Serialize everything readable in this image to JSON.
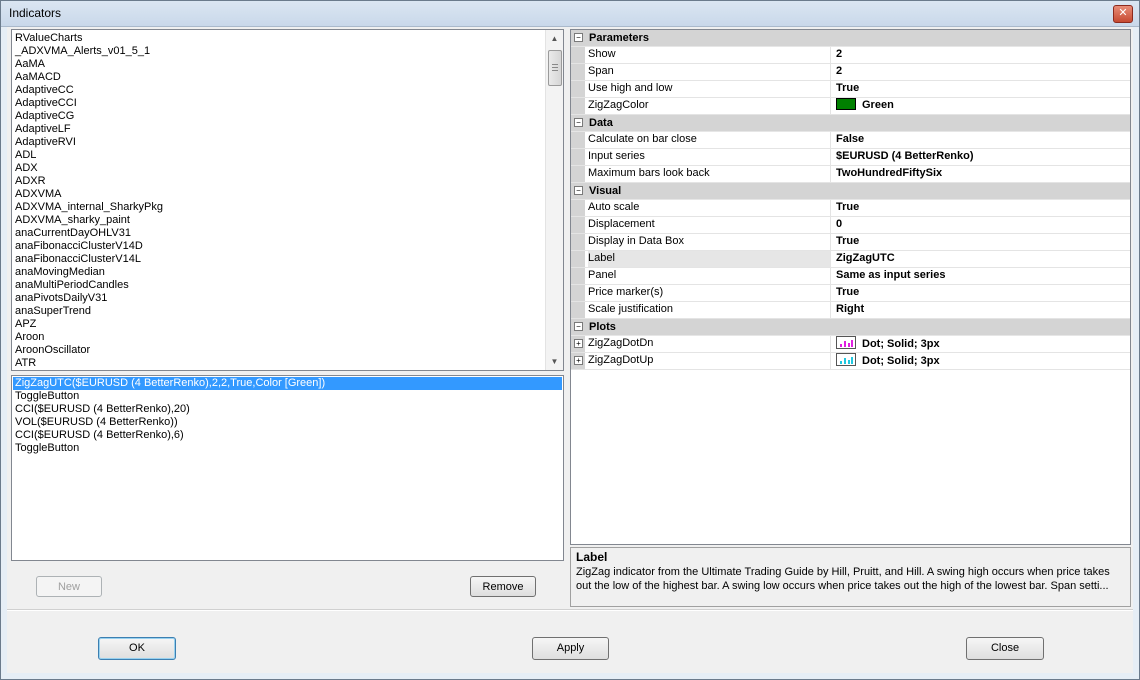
{
  "window": {
    "title": "Indicators"
  },
  "available_indicators": [
    "RValueCharts",
    "_ADXVMA_Alerts_v01_5_1",
    "AaMA",
    "AaMACD",
    "AdaptiveCC",
    "AdaptiveCCI",
    "AdaptiveCG",
    "AdaptiveLF",
    "AdaptiveRVI",
    "ADL",
    "ADX",
    "ADXR",
    "ADXVMA",
    "ADXVMA_internal_SharkyPkg",
    "ADXVMA_sharky_paint",
    "anaCurrentDayOHLV31",
    "anaFibonacciClusterV14D",
    "anaFibonacciClusterV14L",
    "anaMovingMedian",
    "anaMultiPeriodCandles",
    "anaPivotsDailyV31",
    "anaSuperTrend",
    "APZ",
    "Aroon",
    "AroonOscillator",
    "ATR"
  ],
  "applied_indicators": [
    {
      "label": "ZigZagUTC($EURUSD (4 BetterRenko),2,2,True,Color [Green])",
      "selected": true
    },
    {
      "label": "ToggleButton",
      "selected": false
    },
    {
      "label": "CCI($EURUSD (4 BetterRenko),20)",
      "selected": false
    },
    {
      "label": "VOL($EURUSD (4 BetterRenko))",
      "selected": false
    },
    {
      "label": "CCI($EURUSD (4 BetterRenko),6)",
      "selected": false
    },
    {
      "label": "ToggleButton",
      "selected": false
    }
  ],
  "buttons": {
    "new": "New",
    "remove": "Remove",
    "ok": "OK",
    "apply": "Apply",
    "close": "Close"
  },
  "properties": [
    {
      "category": "Parameters",
      "rows": [
        {
          "name": "Show",
          "value": "2"
        },
        {
          "name": "Span",
          "value": "2"
        },
        {
          "name": "Use high and low",
          "value": "True"
        },
        {
          "name": "ZigZagColor",
          "value": "Green",
          "swatch": "#008000"
        }
      ]
    },
    {
      "category": "Data",
      "rows": [
        {
          "name": "Calculate on bar close",
          "value": "False"
        },
        {
          "name": "Input series",
          "value": "$EURUSD (4 BetterRenko)"
        },
        {
          "name": "Maximum bars look back",
          "value": "TwoHundredFiftySix"
        }
      ]
    },
    {
      "category": "Visual",
      "rows": [
        {
          "name": "Auto scale",
          "value": "True"
        },
        {
          "name": "Displacement",
          "value": "0"
        },
        {
          "name": "Display in Data Box",
          "value": "True"
        },
        {
          "name": "Label",
          "value": "ZigZagUTC",
          "selected": true
        },
        {
          "name": "Panel",
          "value": "Same as input series"
        },
        {
          "name": "Price marker(s)",
          "value": "True"
        },
        {
          "name": "Scale justification",
          "value": "Right"
        }
      ]
    },
    {
      "category": "Plots",
      "rows": [
        {
          "name": "ZigZagDotDn",
          "value": "Dot; Solid; 3px",
          "plot_color": "#e020e0",
          "expandable": true
        },
        {
          "name": "ZigZagDotUp",
          "value": "Dot; Solid; 3px",
          "plot_color": "#20c8e0",
          "expandable": true
        }
      ]
    }
  ],
  "description": {
    "title": "Label",
    "text": "ZigZag indicator from the Ultimate Trading Guide by Hill, Pruitt, and Hill. A swing high occurs when price takes out the low of the highest bar. A swing low occurs when price takes out the high of the lowest bar. Span setti..."
  }
}
